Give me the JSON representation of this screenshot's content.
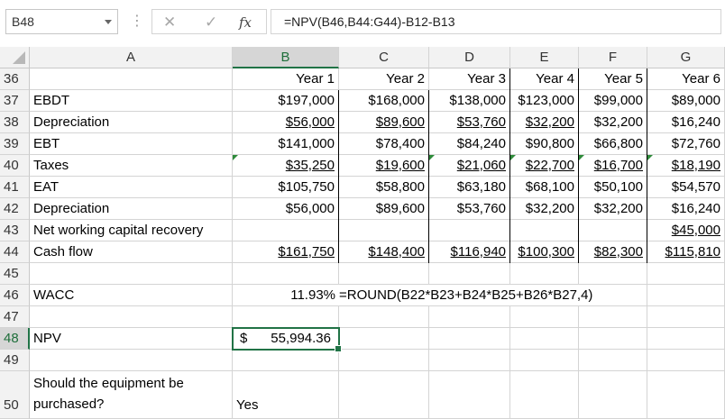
{
  "formula_bar": {
    "name_box": "B48",
    "cancel_icon": "✕",
    "enter_icon": "✓",
    "fx_label": "fx",
    "formula": "=NPV(B46,B44:G44)-B12-B13"
  },
  "columns": [
    "A",
    "B",
    "C",
    "D",
    "E",
    "F",
    "G"
  ],
  "row_numbers": [
    "36",
    "37",
    "38",
    "39",
    "40",
    "41",
    "42",
    "43",
    "44",
    "45",
    "46",
    "47",
    "48",
    "49",
    "50"
  ],
  "rows": {
    "r36": {
      "B": "Year 1",
      "C": "Year 2",
      "D": "Year 3",
      "E": "Year 4",
      "F": "Year 5",
      "G": "Year 6"
    },
    "r37": {
      "A": "EBDT",
      "B": "$197,000",
      "C": "$168,000",
      "D": "$138,000",
      "E": "$123,000",
      "F": "$99,000",
      "G": "$89,000"
    },
    "r38": {
      "A": "Depreciation",
      "B": "$56,000",
      "C": "$89,600",
      "D": "$53,760",
      "E": "$32,200",
      "F": "$32,200",
      "G": "$16,240"
    },
    "r39": {
      "A": "EBT",
      "B": "$141,000",
      "C": "$78,400",
      "D": "$84,240",
      "E": "$90,800",
      "F": "$66,800",
      "G": "$72,760"
    },
    "r40": {
      "A": "Taxes",
      "B": "$35,250",
      "C": "$19,600",
      "D": "$21,060",
      "E": "$22,700",
      "F": "$16,700",
      "G": "$18,190"
    },
    "r41": {
      "A": "EAT",
      "B": "$105,750",
      "C": "$58,800",
      "D": "$63,180",
      "E": "$68,100",
      "F": "$50,100",
      "G": "$54,570"
    },
    "r42": {
      "A": "Depreciation",
      "B": "$56,000",
      "C": "$89,600",
      "D": "$53,760",
      "E": "$32,200",
      "F": "$32,200",
      "G": "$16,240"
    },
    "r43": {
      "A": "Net working capital recovery",
      "G": "$45,000"
    },
    "r44": {
      "A": "Cash flow",
      "B": "$161,750",
      "C": "$148,400",
      "D": "$116,940",
      "E": "$100,300",
      "F": "$82,300",
      "G": "$115,810"
    },
    "r46": {
      "A": "WACC",
      "B": "11.93%",
      "C": "=ROUND(B22*B23+B24*B25+B26*B27,4)"
    },
    "r48": {
      "A": "NPV",
      "B_currency": "$",
      "B_value": "55,994.36"
    },
    "r50": {
      "A_line1": "Should the equipment be",
      "A_line2": "purchased?",
      "B": "Yes"
    }
  }
}
